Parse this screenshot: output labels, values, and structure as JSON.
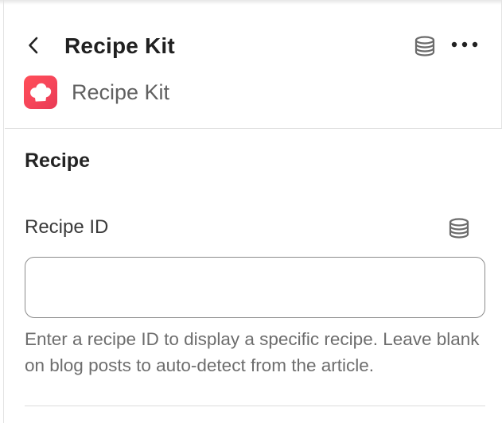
{
  "header": {
    "title": "Recipe Kit",
    "back_icon": "chevron-left-icon",
    "data_source_icon": "database-icon",
    "more_icon": "ellipsis-horizontal-icon"
  },
  "app": {
    "name": "Recipe Kit",
    "logo_icon": "chef-hat-icon",
    "logo_color": "#f5455a"
  },
  "section": {
    "title": "Recipe"
  },
  "recipe_id_field": {
    "label": "Recipe ID",
    "value": "",
    "placeholder": "",
    "dynamic_source_icon": "database-icon",
    "help_text": "Enter a recipe ID to display a specific recipe. Leave blank on blog posts to auto-detect from the article."
  }
}
